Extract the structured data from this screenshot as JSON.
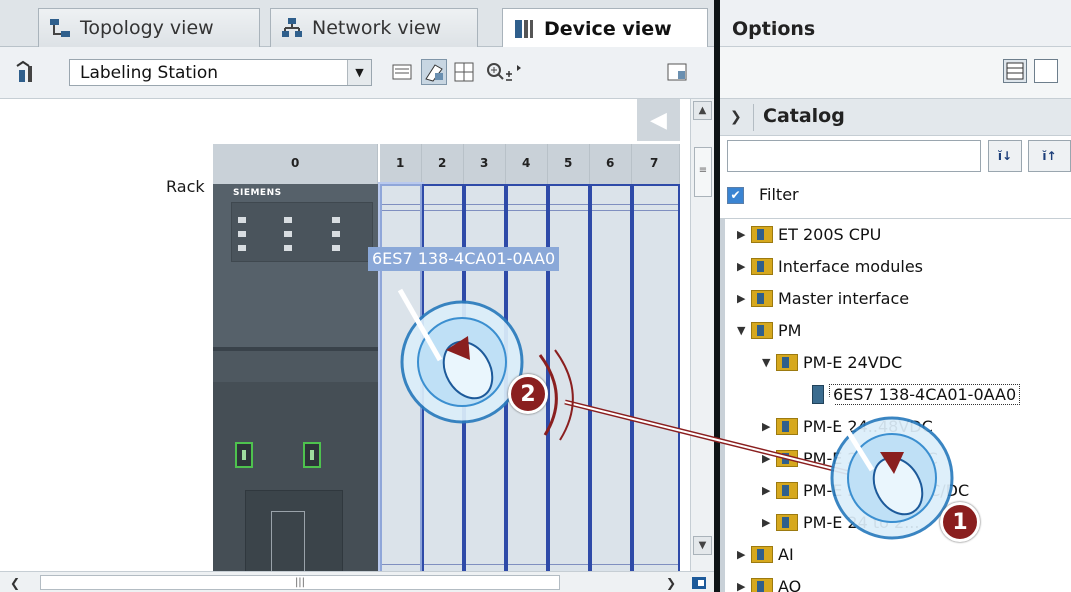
{
  "tabs": [
    {
      "label": "Topology view",
      "icon": "topology-icon",
      "active": false
    },
    {
      "label": "Network view",
      "icon": "network-icon",
      "active": false
    },
    {
      "label": "Device view",
      "icon": "device-icon",
      "active": true
    }
  ],
  "toolbar": {
    "station_value": "Labeling Station"
  },
  "canvas": {
    "rack_label": "Rack",
    "slot_numbers": [
      "0",
      "1",
      "2",
      "3",
      "4",
      "5",
      "6",
      "7"
    ],
    "plc_brand": "SIEMENS",
    "drag_label": "6ES7 138-4CA01-0AA0"
  },
  "options": {
    "title": "Options",
    "catalog_title": "Catalog",
    "search_placeholder": "",
    "filter_label": "Filter",
    "filter_checked": true,
    "tree": [
      {
        "label": "ET 200S CPU",
        "level": 0,
        "expanded": false
      },
      {
        "label": "Interface modules",
        "level": 0,
        "expanded": false
      },
      {
        "label": "Master interface",
        "level": 0,
        "expanded": false
      },
      {
        "label": "PM",
        "level": 0,
        "expanded": true
      },
      {
        "label": "PM-E 24VDC",
        "level": 1,
        "expanded": true
      },
      {
        "label": "6ES7 138-4CA01-0AA0",
        "level": 2,
        "leaf": true
      },
      {
        "label": "PM-E 24..48VDC",
        "level": 1,
        "expanded": false
      },
      {
        "label": "PM-E 24..48 VDC",
        "level": 1,
        "expanded": false
      },
      {
        "label": "PM-E 24..230VAC/DC",
        "level": 1,
        "expanded": false
      },
      {
        "label": "PM-E 24 to 2...",
        "level": 1,
        "expanded": false
      },
      {
        "label": "AI",
        "level": 0,
        "expanded": false
      },
      {
        "label": "AO",
        "level": 0,
        "expanded": false
      }
    ]
  },
  "overlays": {
    "step1": "1",
    "step2": "2"
  },
  "colors": {
    "accent": "#2e4aa8",
    "badge": "#8a1f1f",
    "selection": "#8aa8d8"
  }
}
